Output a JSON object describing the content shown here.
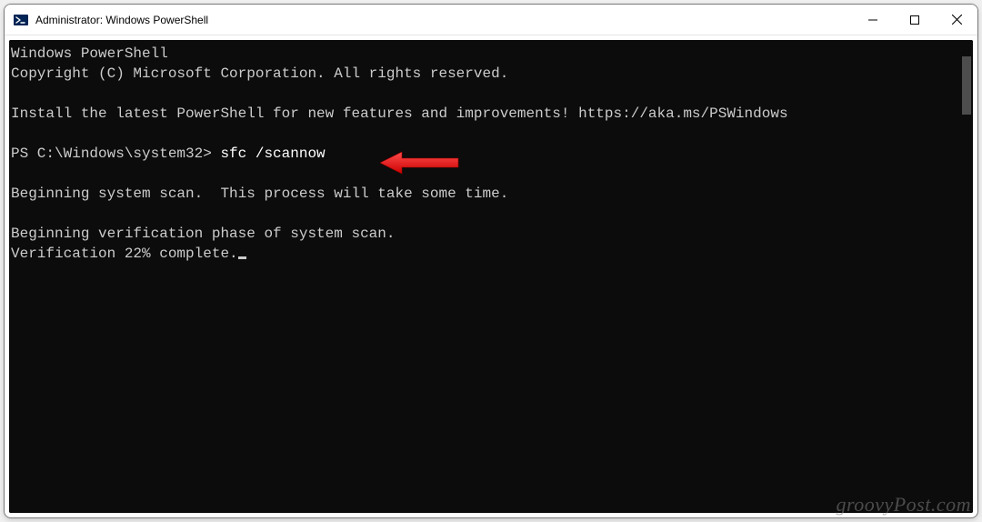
{
  "window": {
    "title": "Administrator: Windows PowerShell"
  },
  "terminal": {
    "line1": "Windows PowerShell",
    "line2": "Copyright (C) Microsoft Corporation. All rights reserved.",
    "line3": "Install the latest PowerShell for new features and improvements! https://aka.ms/PSWindows",
    "prompt": "PS C:\\Windows\\system32> ",
    "command": "sfc /scannow",
    "line5": "Beginning system scan.  This process will take some time.",
    "line6": "Beginning verification phase of system scan.",
    "line7": "Verification 22% complete."
  },
  "watermark": "groovyPost.com"
}
